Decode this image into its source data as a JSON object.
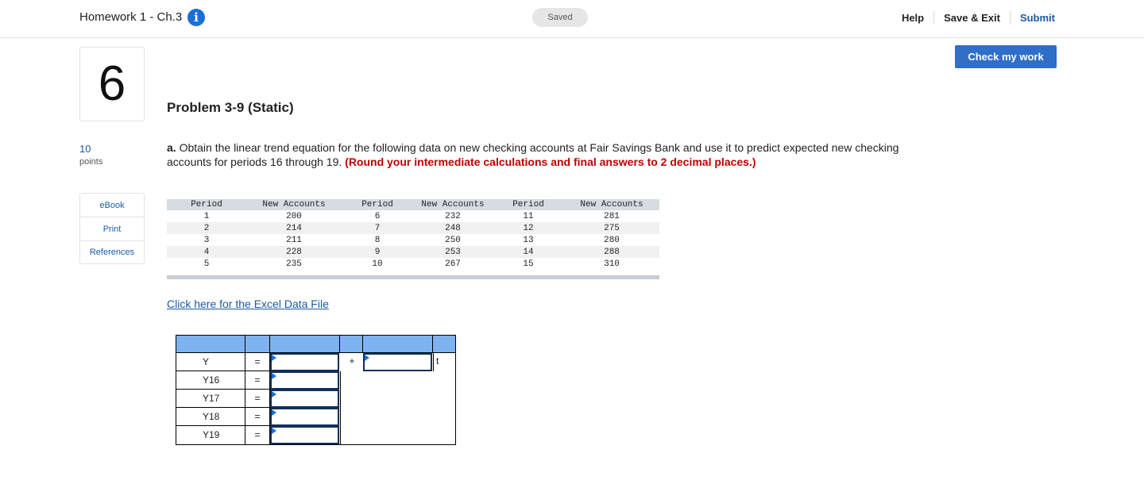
{
  "header": {
    "title": "Homework 1 - Ch.3",
    "info_icon": "i",
    "saved": "Saved",
    "help": "Help",
    "save_exit": "Save & Exit",
    "submit": "Submit"
  },
  "check_button": "Check my work",
  "question": {
    "number": "6",
    "points_value": "10",
    "points_label": "points",
    "title": "Problem 3-9 (Static)",
    "part_label": "a.",
    "text": "Obtain the linear trend equation for the following data on new checking accounts at Fair Savings Bank and use it to predict expected new checking accounts for periods 16 through 19.",
    "instruction": "(Round your intermediate calculations and final answers to 2 decimal places.)"
  },
  "side_menu": {
    "items": [
      {
        "label": "eBook"
      },
      {
        "label": "Print"
      },
      {
        "label": "References"
      }
    ]
  },
  "data_table": {
    "headers": [
      "Period",
      "New Accounts",
      "Period",
      "New Accounts",
      "Period",
      "New Accounts"
    ],
    "rows": [
      [
        "1",
        "200",
        "6",
        "232",
        "11",
        "281"
      ],
      [
        "2",
        "214",
        "7",
        "248",
        "12",
        "275"
      ],
      [
        "3",
        "211",
        "8",
        "250",
        "13",
        "280"
      ],
      [
        "4",
        "228",
        "9",
        "253",
        "14",
        "288"
      ],
      [
        "5",
        "235",
        "10",
        "267",
        "15",
        "310"
      ]
    ]
  },
  "excel_link": "Click here for the Excel Data File",
  "answer_table": {
    "rows": [
      {
        "label": "Y",
        "eq": "=",
        "plus": "+",
        "t": "t"
      },
      {
        "label": "Y16",
        "eq": "="
      },
      {
        "label": "Y17",
        "eq": "="
      },
      {
        "label": "Y18",
        "eq": "="
      },
      {
        "label": "Y19",
        "eq": "="
      }
    ]
  }
}
